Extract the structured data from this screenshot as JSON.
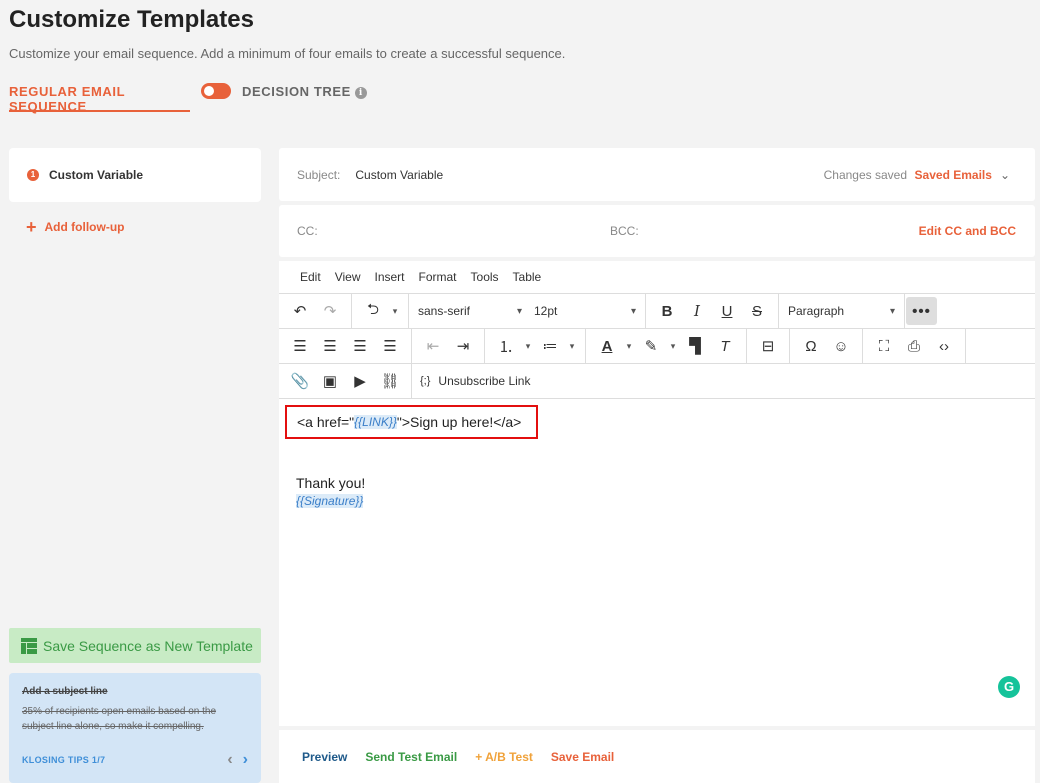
{
  "header": {
    "title": "Customize Templates",
    "subtitle": "Customize your email sequence. Add a minimum of four emails to create a successful sequence."
  },
  "mode_tabs": {
    "regular": "REGULAR EMAIL SEQUENCE",
    "decision": "DECISION TREE",
    "info": "i"
  },
  "sidebar": {
    "steps": [
      {
        "num": "1",
        "label": "Custom Variable"
      }
    ],
    "add_followup": "Add follow-up",
    "save_template": "Save Sequence as New Template",
    "tip": {
      "title": "Add a subject line",
      "body": "35% of recipients open emails based on the subject line alone, so make it compelling.",
      "counter": "KLOSING TIPS 1/7"
    }
  },
  "email": {
    "subject_label": "Subject:",
    "subject_value": "Custom Variable",
    "changes_saved": "Changes saved",
    "saved_emails": "Saved Emails",
    "cc_label": "CC:",
    "bcc_label": "BCC:",
    "edit_cc": "Edit CC and BCC"
  },
  "editor": {
    "menu": [
      "Edit",
      "View",
      "Insert",
      "Format",
      "Tools",
      "Table"
    ],
    "font_family": "sans-serif",
    "font_size": "12pt",
    "block_format": "Paragraph",
    "unsubscribe": "Unsubscribe Link",
    "unsubscribe_icon": "{;}",
    "body": {
      "link_prefix": "<a href=\"",
      "link_var": "{{LINK}}",
      "link_suffix": "\">Sign up here!</a>",
      "thanks": "Thank you!",
      "signature": "{{Signature}}"
    }
  },
  "footer": {
    "preview": "Preview",
    "send_test": "Send Test Email",
    "ab_test": "+ A/B Test",
    "save": "Save Email"
  },
  "colors": {
    "accent": "#e8613a",
    "green": "#3a9a45",
    "blue": "#3f8fd8",
    "grammarly": "#15c39a"
  }
}
